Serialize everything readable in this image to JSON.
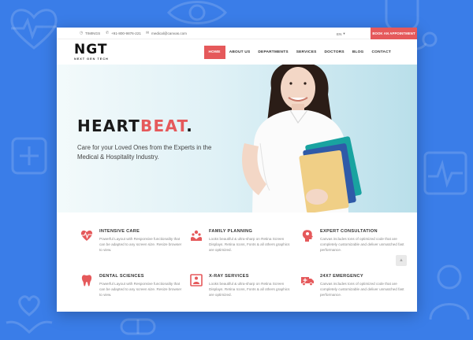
{
  "topbar": {
    "timings": "TIMINGS",
    "phone": "+91-800-9876-221",
    "email": "medical@canvas.com",
    "lang": "EN",
    "cta": "BOOK AN APPOINTMENT"
  },
  "logo": {
    "main": "NGT",
    "sub": "NEXT GEN TECH"
  },
  "nav": {
    "items": [
      {
        "label": "HOME",
        "active": true
      },
      {
        "label": "ABOUT US"
      },
      {
        "label": "DEPARTMENTS"
      },
      {
        "label": "SERVICES"
      },
      {
        "label": "DOCTORS"
      },
      {
        "label": "BLOG"
      },
      {
        "label": "CONTACT"
      }
    ]
  },
  "hero": {
    "title_dark": "HEART",
    "title_red": "BEAT",
    "title_dot": ".",
    "subtitle": "Care for your Loved Ones from the Experts in the Medical & Hospitality Industry."
  },
  "services": [
    {
      "icon": "heartbeat-icon",
      "title": "INTENSIVE CARE",
      "desc": "Powerful Layout with Responsive functionality that can be adapted to any screen size. Resize browser to view."
    },
    {
      "icon": "hands-icon",
      "title": "FAMILY PLANNING",
      "desc": "Looks beautiful & ultra-sharp on Retina Screen Displays. Retina Icons, Fonts & all others graphics are optimized."
    },
    {
      "icon": "head-icon",
      "title": "EXPERT CONSULTATION",
      "desc": "Canvas includes tons of optimized code that are completely customizable and deliver unmatched fast performance."
    },
    {
      "icon": "tooth-icon",
      "title": "DENTAL SCIENCES",
      "desc": "Powerful Layout with Responsive functionality that can be adapted to any screen size. Resize browser to view."
    },
    {
      "icon": "xray-icon",
      "title": "X-RAY SERVICES",
      "desc": "Looks beautiful & ultra-sharp on Retina Screen Displays. Retina Icons, Fonts & all others graphics are optimized."
    },
    {
      "icon": "ambulance-icon",
      "title": "24X7 EMERGENCY",
      "desc": "Canvas includes tons of optimized code that are completely customizable and deliver unmatched fast performance."
    }
  ],
  "colors": {
    "accent": "#e5595b",
    "background": "#3a7de8"
  }
}
